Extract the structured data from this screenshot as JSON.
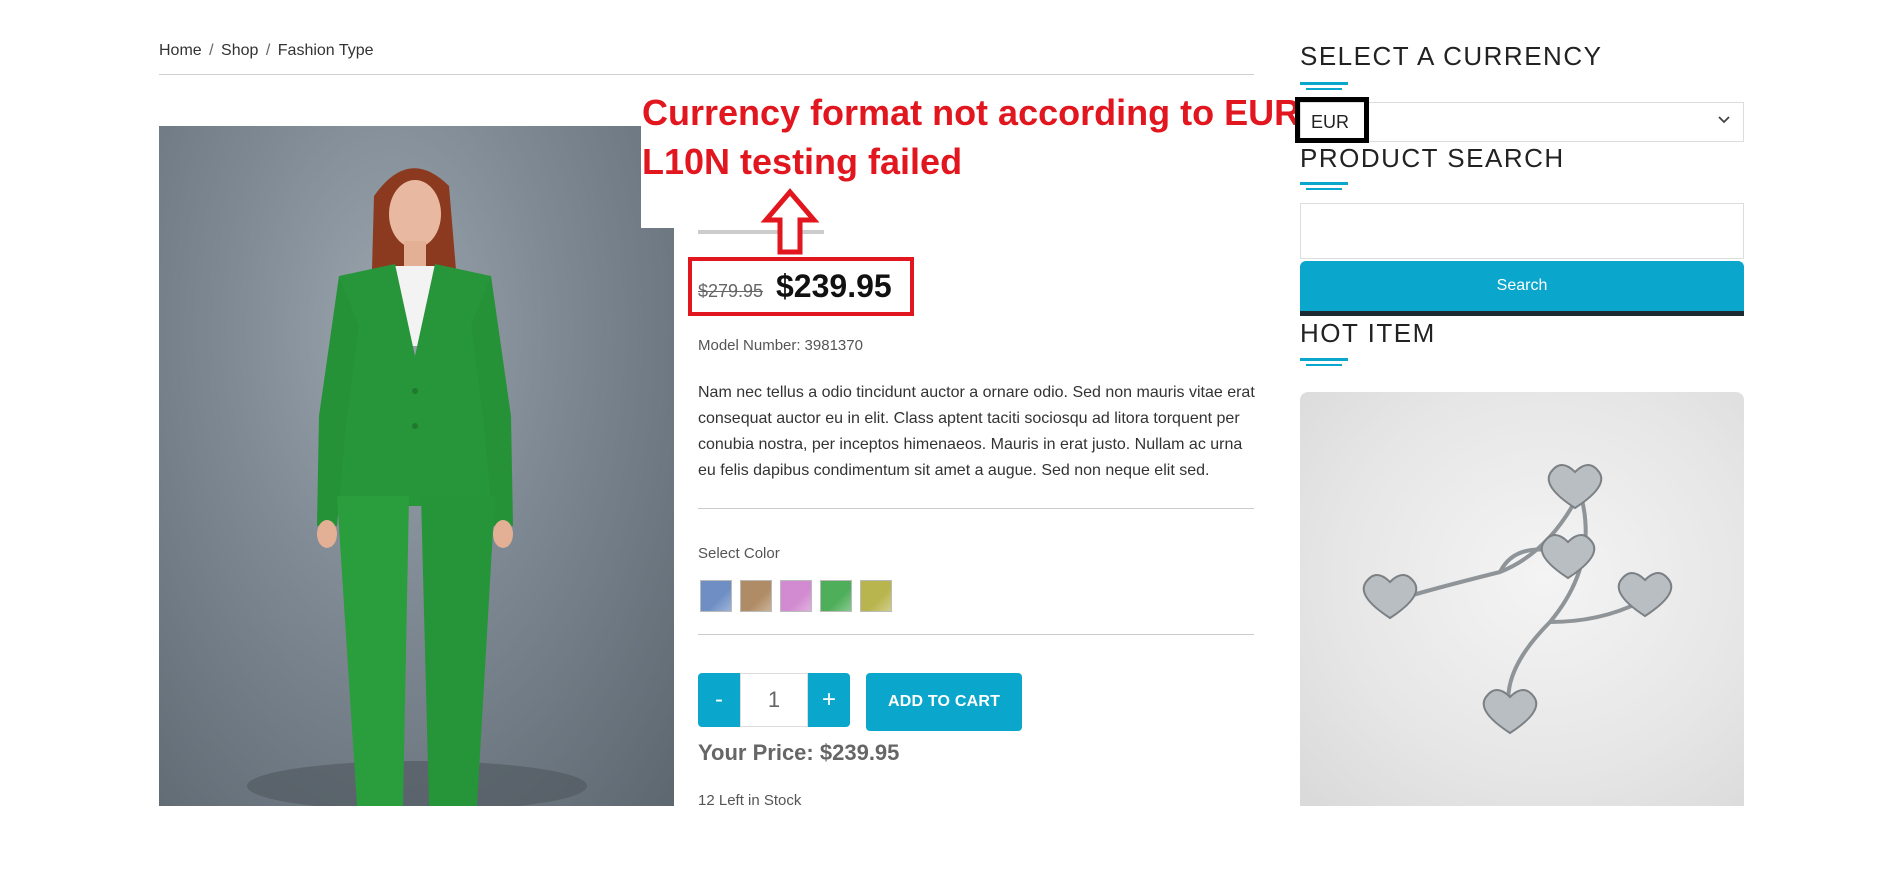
{
  "breadcrumb": {
    "home": "Home",
    "shop": "Shop",
    "current": "Fashion Type",
    "separator": "/"
  },
  "annotation": {
    "line1": "Currency format not according to EUR",
    "line2": "L10N testing failed",
    "color": "#e1161f"
  },
  "product": {
    "old_price": "$279.95",
    "price": "$239.95",
    "model_label": "Model Number:",
    "model_number": "3981370",
    "description": "Nam nec tellus a odio tincidunt auctor a ornare odio. Sed non mauris vitae erat consequat auctor eu in elit. Class aptent taciti sociosqu ad litora torquent per conubia nostra, per inceptos himenaeos. Mauris in erat justo. Nullam ac urna eu felis dapibus condimentum sit amet a augue. Sed non neque elit sed.",
    "select_color_label": "Select Color",
    "colors": [
      "#6f8fc4",
      "#b08c66",
      "#d28ad0",
      "#4fae5a",
      "#b8b54e"
    ],
    "quantity": "1",
    "minus_label": "-",
    "plus_label": "+",
    "add_to_cart_label": "ADD TO CART",
    "your_price_label": "Your Price:",
    "your_price_value": "$239.95",
    "stock_text": "12 Left in Stock"
  },
  "sidebar": {
    "currency_heading": "SELECT A CURRENCY",
    "currency_selected": "EUR",
    "search_heading": "PRODUCT SEARCH",
    "search_placeholder": "",
    "search_button": "Search",
    "hot_heading": "HOT ITEM"
  },
  "colors": {
    "accent": "#0aa6cc",
    "annotation_red": "#e1161f"
  },
  "icons": {
    "select_chevron": "chevron-down-icon",
    "annotation_arrow": "arrow-up-icon"
  }
}
